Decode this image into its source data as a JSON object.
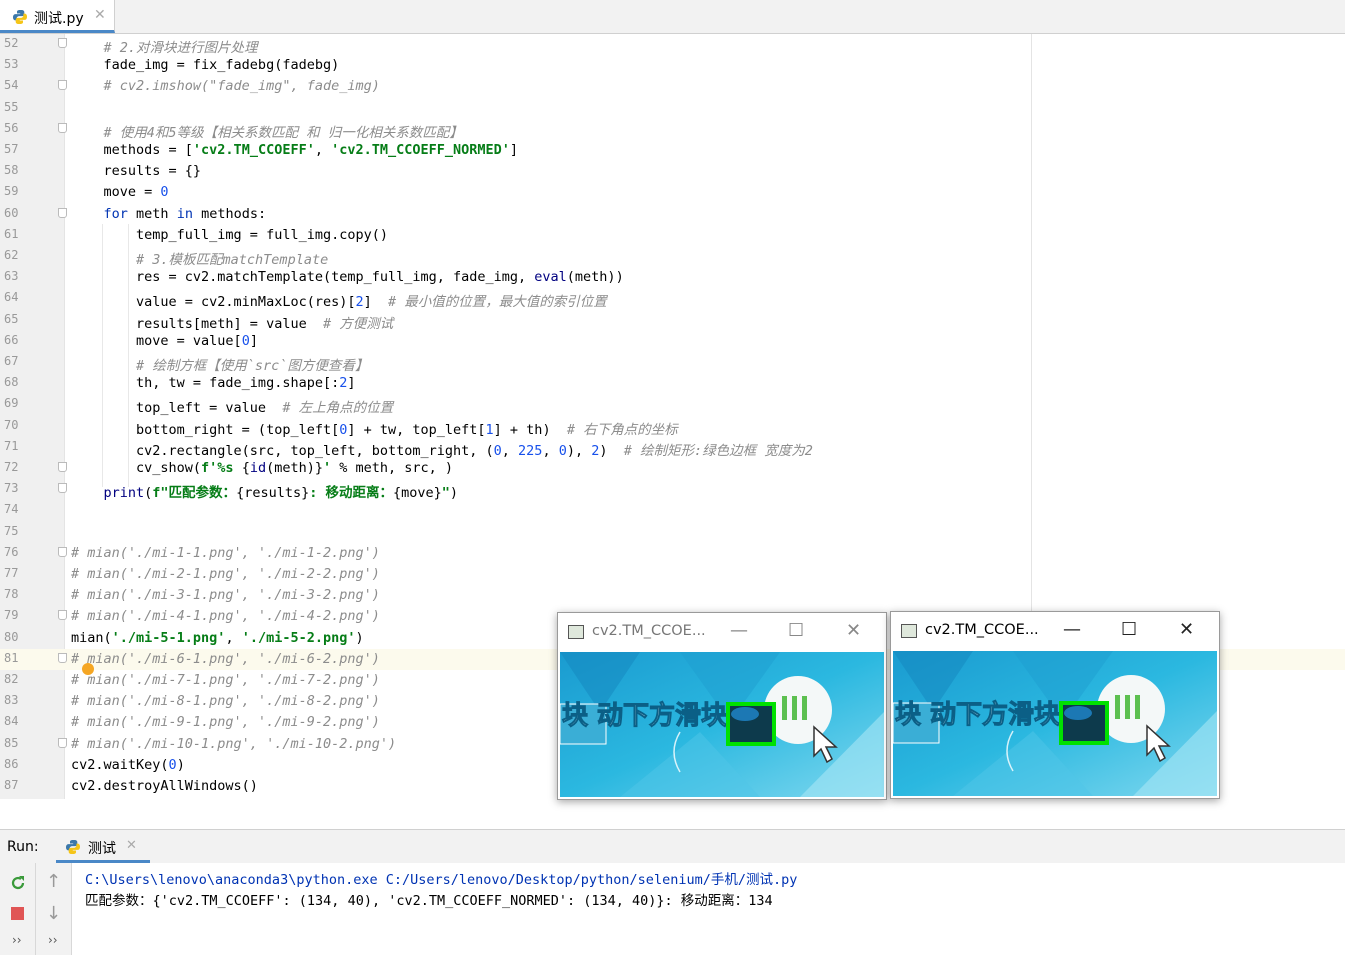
{
  "file_tab": {
    "name": "测试.py",
    "close": "✕"
  },
  "editor_lines": [
    {
      "n": "52",
      "html": "    <span class=\"cmt\"># 2.对滑块进行图片处理</span>"
    },
    {
      "n": "53",
      "html": "    fade_img = fix_fadebg(fadebg)"
    },
    {
      "n": "54",
      "html": "    <span class=\"cmt\"># cv2.imshow(\"fade_img\", fade_img)</span>"
    },
    {
      "n": "55",
      "html": ""
    },
    {
      "n": "56",
      "html": "    <span class=\"cmt\"># 使用4和5等级【相关系数匹配 和 归一化相关系数匹配】</span>"
    },
    {
      "n": "57",
      "html": "    methods = [<span class=\"str\">'cv2.TM_CCOEFF'</span>, <span class=\"str\">'cv2.TM_CCOEFF_NORMED'</span>]"
    },
    {
      "n": "58",
      "html": "    results = {}"
    },
    {
      "n": "59",
      "html": "    move = <span class=\"num\">0</span>"
    },
    {
      "n": "60",
      "html": "    <span class=\"kw\">for</span> meth <span class=\"kw\">in</span> methods:"
    },
    {
      "n": "61",
      "html": "        temp_full_img = full_img.copy()"
    },
    {
      "n": "62",
      "html": "        <span class=\"cmt\"># 3.模板匹配matchTemplate</span>"
    },
    {
      "n": "63",
      "html": "        res = cv2.matchTemplate(temp_full_img, fade_img, <span class=\"bi\">eval</span>(meth))"
    },
    {
      "n": "64",
      "html": "        value = cv2.minMaxLoc(res)[<span class=\"num\">2</span>]  <span class=\"cmt\"># 最小值的位置，最大值的索引位置</span>"
    },
    {
      "n": "65",
      "html": "        results[meth] = value  <span class=\"cmt\"># 方便测试</span>"
    },
    {
      "n": "66",
      "html": "        move = value[<span class=\"num\">0</span>]"
    },
    {
      "n": "67",
      "html": "        <span class=\"cmt\"># 绘制方框【使用`src`图方便查看】</span>"
    },
    {
      "n": "68",
      "html": "        th, tw = fade_img.shape[:<span class=\"num\">2</span>]"
    },
    {
      "n": "69",
      "html": "        top_left = value  <span class=\"cmt\"># 左上角点的位置</span>"
    },
    {
      "n": "70",
      "html": "        bottom_right = (top_left[<span class=\"num\">0</span>] + tw, top_left[<span class=\"num\">1</span>] + th)  <span class=\"cmt\"># 右下角点的坐标</span>"
    },
    {
      "n": "71",
      "html": "        cv2.rectangle(src, top_left, bottom_right, (<span class=\"num\">0</span>, <span class=\"num\">225</span>, <span class=\"num\">0</span>), <span class=\"num\">2</span>)  <span class=\"cmt\"># 绘制矩形:绿色边框 宽度为2</span>"
    },
    {
      "n": "72",
      "html": "        cv_show(<span class=\"str\">f'%s </span>{<span class=\"bi\">id</span>(meth)}<span class=\"str\">'</span> % meth, src, )"
    },
    {
      "n": "73",
      "html": "    <span class=\"bi\">print</span>(<span class=\"str\">f\"匹配参数：</span>{results}<span class=\"str\">: 移动距离：</span>{move}<span class=\"str\">\"</span>)"
    },
    {
      "n": "74",
      "html": ""
    },
    {
      "n": "75",
      "html": ""
    },
    {
      "n": "76",
      "html": "<span class=\"cmt\"># mian('./mi-1-1.png', './mi-1-2.png')</span>"
    },
    {
      "n": "77",
      "html": "<span class=\"cmt\"># mian('./mi-2-1.png', './mi-2-2.png')</span>"
    },
    {
      "n": "78",
      "html": "<span class=\"cmt\"># mian('./mi-3-1.png', './mi-3-2.png')</span>"
    },
    {
      "n": "79",
      "html": "<span class=\"cmt\"># mian('./mi-4-1.png', './mi-4-2.png')</span>"
    },
    {
      "n": "80",
      "html": "mian(<span class=\"str\">'./mi-5-1.png'</span>, <span class=\"str\">'./mi-5-2.png'</span>)"
    },
    {
      "n": "81",
      "html": "<span class=\"cmt\"># mian('./mi-6-1.png', './mi-6-2.png')</span>"
    },
    {
      "n": "82",
      "html": "<span class=\"cmt\"># mian('./mi-7-1.png', './mi-7-2.png')</span>"
    },
    {
      "n": "83",
      "html": "<span class=\"cmt\"># mian('./mi-8-1.png', './mi-8-2.png')</span>"
    },
    {
      "n": "84",
      "html": "<span class=\"cmt\"># mian('./mi-9-1.png', './mi-9-2.png')</span>"
    },
    {
      "n": "85",
      "html": "<span class=\"cmt\"># mian('./mi-10-1.png', './mi-10-2.png')</span>"
    },
    {
      "n": "86",
      "html": "cv2.waitKey(<span class=\"num\">0</span>)"
    },
    {
      "n": "87",
      "html": "cv2.destroyAllWindows()"
    }
  ],
  "current_line": "81",
  "cv_windows": [
    {
      "title": "cv2.TM_CCOE...",
      "image_text": "块 动下方滑块"
    },
    {
      "title": "cv2.TM_CCOE...",
      "image_text": "块 动下方滑块"
    }
  ],
  "window_buttons": {
    "min": "—",
    "max": "☐",
    "close": "✕"
  },
  "run_panel": {
    "label": "Run:",
    "tab_name": "测试",
    "tab_close": "✕",
    "console_lines": [
      {
        "text": "C:\\Users\\lenovo\\anaconda3\\python.exe C:/Users/lenovo/Desktop/python/selenium/手机/测试.py",
        "color": "#0033b3"
      },
      {
        "text": "匹配参数：{'cv2.TM_CCOEFF': (134, 40), 'cv2.TM_CCOEFF_NORMED': (134, 40)}: 移动距离：134",
        "color": "#000000"
      }
    ]
  },
  "colors": {
    "accent": "#4a88c7",
    "keyword": "#0033b3",
    "string": "#067d17",
    "number": "#1750eb",
    "comment": "#8c8c8c",
    "match_box": "#00e100"
  }
}
